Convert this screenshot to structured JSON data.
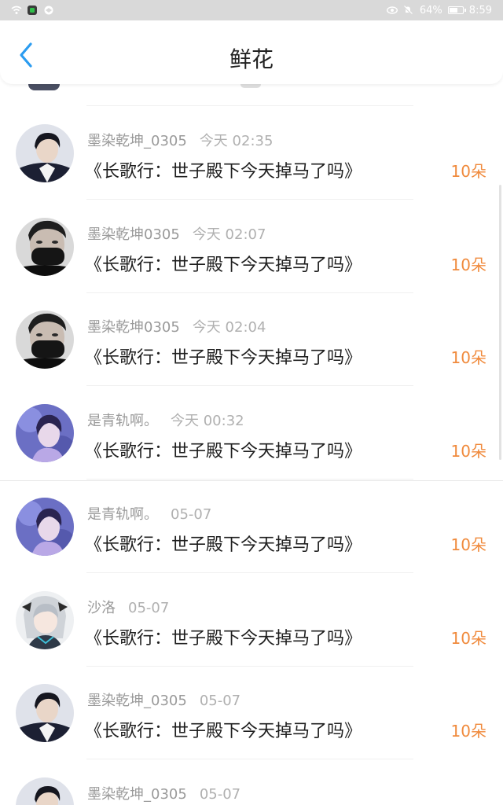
{
  "status_bar": {
    "battery_percent": "64%",
    "battery_level": 0.64,
    "time": "8:59",
    "icons": [
      "signal-icon",
      "app-notification-icon",
      "browser-icon",
      "eye-icon",
      "mute-icon",
      "battery-icon"
    ]
  },
  "header": {
    "title": "鲜花",
    "back_icon": "chevron-left-icon"
  },
  "colors": {
    "accent_blue": "#2b9cf0",
    "count_orange": "#f08a3c",
    "status_bar_bg": "#d9d9d9"
  },
  "gifts": [
    {
      "sender": "墨染乾坤_0305",
      "time": "今天 02:35",
      "book": "《长歌行：世子殿下今天掉马了吗》",
      "count": "10朵",
      "avatar_style": "dark-portrait"
    },
    {
      "sender": "墨染乾坤0305",
      "time": "今天 02:07",
      "book": "《长歌行：世子殿下今天掉马了吗》",
      "count": "10朵",
      "avatar_style": "masked-man"
    },
    {
      "sender": "墨染乾坤0305",
      "time": "今天 02:04",
      "book": "《长歌行：世子殿下今天掉马了吗》",
      "count": "10朵",
      "avatar_style": "masked-man"
    },
    {
      "sender": "是青轨啊。",
      "time": "今天 00:32",
      "book": "《长歌行：世子殿下今天掉马了吗》",
      "count": "10朵",
      "avatar_style": "purple-girl"
    },
    {
      "sender": "是青轨啊。",
      "time": "05-07",
      "book": "《长歌行：世子殿下今天掉马了吗》",
      "count": "10朵",
      "avatar_style": "purple-girl"
    },
    {
      "sender": "沙洛",
      "time": "05-07",
      "book": "《长歌行：世子殿下今天掉马了吗》",
      "count": "10朵",
      "avatar_style": "anime-girl"
    },
    {
      "sender": "墨染乾坤_0305",
      "time": "05-07",
      "book": "《长歌行：世子殿下今天掉马了吗》",
      "count": "10朵",
      "avatar_style": "dark-portrait"
    },
    {
      "sender": "墨染乾坤_0305",
      "time": "05-07",
      "book": "",
      "count": "",
      "avatar_style": "dark-portrait"
    }
  ]
}
